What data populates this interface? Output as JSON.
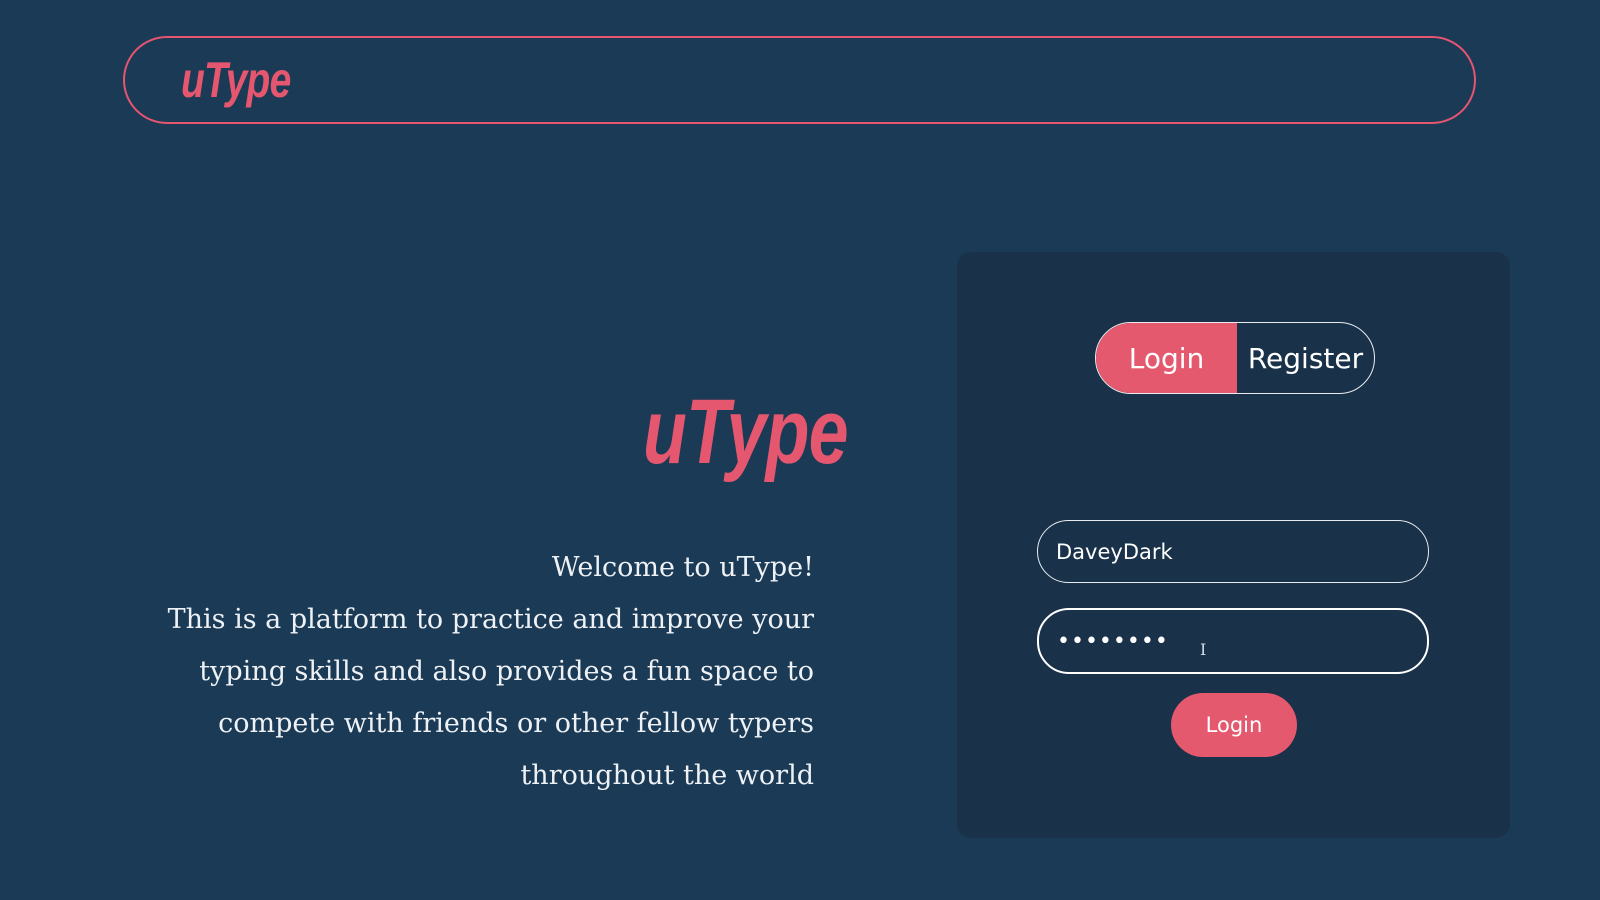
{
  "header": {
    "logo_text": "uType"
  },
  "hero": {
    "logo_text": "uType",
    "welcome": "Welcome to uType!",
    "description": "This is a platform to practice and improve your typing skills and also provides a fun space to compete with friends or other fellow typers throughout the world"
  },
  "auth": {
    "tabs": {
      "login_label": "Login",
      "register_label": "Register",
      "active": "Login"
    },
    "username_value": "DaveyDark",
    "password_value": "••••••••",
    "submit_label": "Login"
  },
  "colors": {
    "background": "#1b3a55",
    "card": "#19324a",
    "accent": "#e5596f",
    "text": "#eef1f5"
  },
  "icons": {
    "cursor": "text-cursor-icon"
  }
}
